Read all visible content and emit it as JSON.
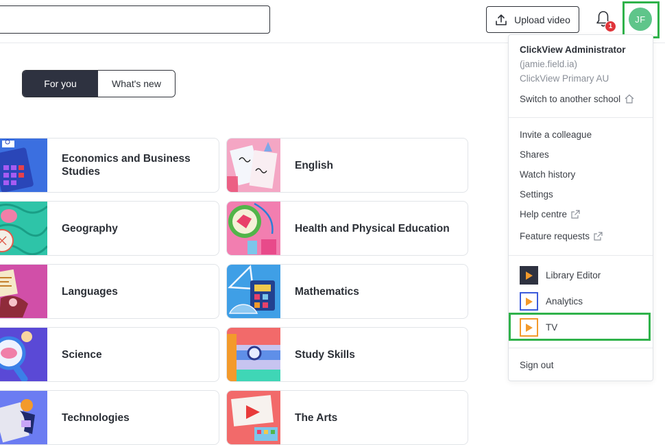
{
  "header": {
    "upload_label": "Upload video",
    "notification_count": "1",
    "avatar_initials": "JF"
  },
  "tabs": [
    {
      "label": "For you",
      "active": true
    },
    {
      "label": "What's new",
      "active": false
    }
  ],
  "subjects": [
    {
      "label": "Economics and Business Studies"
    },
    {
      "label": "English"
    },
    {
      "label": "Geography"
    },
    {
      "label": "Health and Physical Education"
    },
    {
      "label": "Languages"
    },
    {
      "label": "Mathematics"
    },
    {
      "label": "Science"
    },
    {
      "label": "Study Skills"
    },
    {
      "label": "Technologies"
    },
    {
      "label": "The Arts"
    }
  ],
  "menu": {
    "user_name": "ClickView Administrator",
    "username": "(jamie.field.ia)",
    "school": "ClickView Primary AU",
    "switch_school": "Switch to another school",
    "items": [
      {
        "label": "Invite a colleague"
      },
      {
        "label": "Shares"
      },
      {
        "label": "Watch history"
      },
      {
        "label": "Settings"
      },
      {
        "label": "Help centre"
      },
      {
        "label": "Feature requests"
      }
    ],
    "apps": [
      {
        "label": "Library Editor",
        "color": "#f39a2b",
        "bg": "#2e3240"
      },
      {
        "label": "Analytics",
        "color": "#f39a2b",
        "border": "#3b5bdb"
      },
      {
        "label": "TV",
        "color": "#f39a2b",
        "border": "#f39a2b"
      }
    ],
    "sign_out": "Sign out"
  },
  "colors": {
    "accent_dark": "#2e3240",
    "highlight_green": "#2fb24a",
    "avatar_green": "#5fc58a",
    "badge_red": "#e0353a"
  }
}
